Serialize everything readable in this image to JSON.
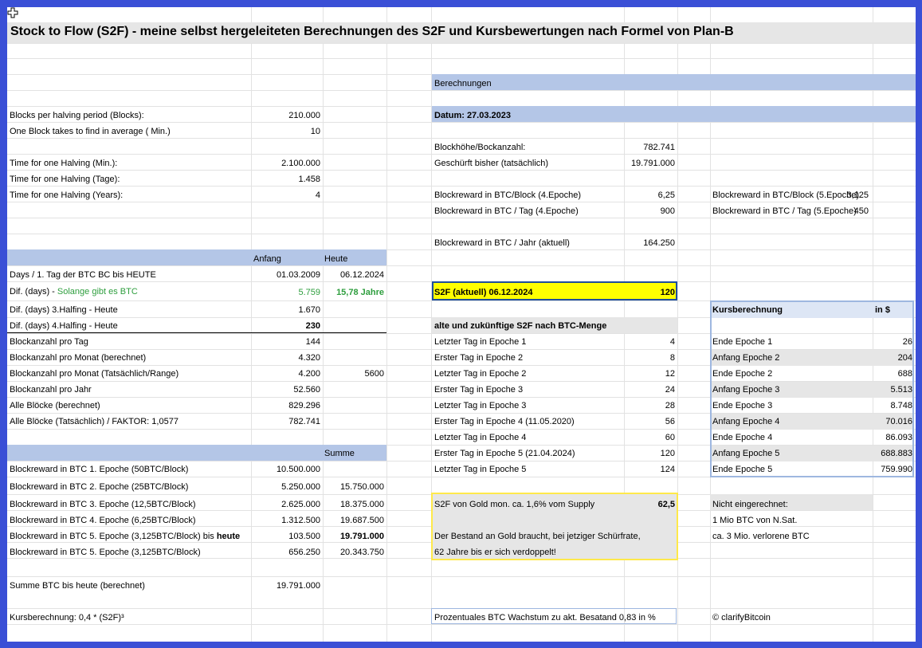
{
  "title": "Stock to Flow (S2F) - meine selbst hergeleiteten Berechnungen des S2F und Kursbewertungen nach Formel von Plan-B",
  "left": {
    "halving": [
      {
        "label": "Blocks per halving period (Blocks):",
        "value": "210.000"
      },
      {
        "label": "One Block takes to find in average ( Min.)",
        "value": "10"
      },
      {
        "label": "Time for one Halving (Min.):",
        "value": "2.100.000"
      },
      {
        "label": "Time for one Halving (Tage):",
        "value": "1.458"
      },
      {
        "label": "Time for one Halving (Years):",
        "value": "4"
      }
    ],
    "header_anfang": "Anfang",
    "header_heute": "Heute",
    "days": {
      "label": "Days / 1. Tag der BTC BC bis  HEUTE",
      "anfang": "01.03.2009",
      "heute": "06.12.2024"
    },
    "dif": {
      "label_a": "Dif. (days) - ",
      "label_b": "Solange gibt es BTC",
      "value": "5.759",
      "years": "15,78  Jahre"
    },
    "halfing3": {
      "label": "Dif. (days) 3.Halfing - Heute",
      "value": "1.670"
    },
    "halfing4": {
      "label": "Dif. (days) 4.Halfing - Heute",
      "value": "230"
    },
    "blocks": [
      {
        "label": "Blockanzahl pro Tag",
        "value": "144",
        "extra": ""
      },
      {
        "label": "Blockanzahl pro Monat (berechnet)",
        "value": "4.320",
        "extra": ""
      },
      {
        "label": "Blockanzahl pro Monat (Tatsächlich/Range)",
        "value": "4.200",
        "extra": "5600"
      },
      {
        "label": "Blockanzahl pro Jahr",
        "value": "52.560",
        "extra": ""
      },
      {
        "label": "Alle Blöcke (berechnet)",
        "value": "829.296",
        "extra": ""
      },
      {
        "label": "Alle Blöcke (Tatsächlich) / FAKTOR: 1,0577",
        "value": "782.741",
        "extra": ""
      }
    ],
    "summe_header": "Summe",
    "epochs": [
      {
        "label": "Blockreward in BTC 1. Epoche (50BTC/Block)",
        "value": "10.500.000",
        "sum": ""
      },
      {
        "label": "Blockreward in BTC 2. Epoche (25BTC/Block)",
        "value": "5.250.000",
        "sum": "15.750.000"
      },
      {
        "label": "Blockreward in BTC 3. Epoche (12,5BTC/Block)",
        "value": "2.625.000",
        "sum": "18.375.000"
      },
      {
        "label": "Blockreward in BTC 4. Epoche (6,25BTC/Block)",
        "value": "1.312.500",
        "sum": "19.687.500"
      },
      {
        "label": "Blockreward in BTC 5. Epoche (3,125BTC/Block) bis ",
        "label_bold": "heute",
        "value": "103.500",
        "sum": "19.791.000"
      },
      {
        "label": "Blockreward in BTC 5. Epoche (3,125BTC/Block)",
        "value": "656.250",
        "sum": "20.343.750"
      }
    ],
    "summe_btc": {
      "label": "Summe BTC bis heute (berechnet)",
      "value": "19.791.000"
    },
    "kursberechnung": "Kursberechnung: 0,4 * (S2F)³"
  },
  "middle": {
    "berechnungen": "Berechnungen",
    "datum": "Datum: 27.03.2023",
    "rows": [
      {
        "label": "Blockhöhe/Bockanzahl:",
        "value": "782.741"
      },
      {
        "label": "Geschürft bisher (tatsächlich)",
        "value": "19.791.000"
      },
      {
        "label": "Blockreward in BTC/Block (4.Epoche)",
        "value": "6,25"
      },
      {
        "label": "Blockreward in BTC / Tag (4.Epoche)",
        "value": "900"
      },
      {
        "label": "Blockreward in BTC / Jahr (aktuell)",
        "value": "164.250"
      }
    ],
    "s2f_label": "S2F (aktuell) 06.12.2024",
    "s2f_value": "120",
    "s2f_header": "alte und zukünftige S2F nach BTC-Menge",
    "s2f_rows": [
      {
        "label": "Letzter Tag in Epoche 1",
        "value": "4"
      },
      {
        "label": "Erster Tag in Epoche 2",
        "value": "8"
      },
      {
        "label": "Letzter Tag in Epoche 2",
        "value": "12"
      },
      {
        "label": "Erster Tag in Epoche 3",
        "value": "24"
      },
      {
        "label": "Letzter Tag in Epoche 3",
        "value": "28"
      },
      {
        "label": "Erster Tag in Epoche 4 (11.05.2020)",
        "value": "56"
      },
      {
        "label": "Letzter Tag in Epoche 4",
        "value": "60"
      },
      {
        "label": "Erster Tag in Epoche 5 (21.04.2024)",
        "value": "120"
      },
      {
        "label": "Letzter Tag in Epoche 5",
        "value": "124"
      }
    ],
    "gold_label": "S2F von Gold mon. ca. 1,6% vom Supply",
    "gold_value": "62,5",
    "gold_text1": "Der Bestand an Gold braucht, bei jetziger Schürfrate,",
    "gold_text2": "62 Jahre bis er sich verdoppelt!",
    "wachstum": "Prozentuales BTC Wachstum zu akt. Besatand  0,83  in %"
  },
  "right": {
    "rows": [
      {
        "label": "Blockreward in BTC/Block (5.Epoche)",
        "value": "3,125"
      },
      {
        "label": "Blockreward in BTC / Tag (5.Epoche)",
        "value": "450"
      }
    ],
    "kurs_header": "Kursberechnung",
    "kurs_unit": "in $",
    "kurs_rows": [
      {
        "label": "Ende Epoche 1",
        "value": "26"
      },
      {
        "label": "Anfang Epoche 2",
        "value": "204"
      },
      {
        "label": "Ende Epoche 2",
        "value": "688"
      },
      {
        "label": "Anfang Epoche 3",
        "value": "5.513"
      },
      {
        "label": "Ende Epoche 3",
        "value": "8.748"
      },
      {
        "label": "Anfang Epoche 4",
        "value": "70.016"
      },
      {
        "label": "Ende Epoche 4",
        "value": "86.093"
      },
      {
        "label": "Anfang Epoche 5",
        "value": "688.883"
      },
      {
        "label": "Ende Epoche 5",
        "value": "759.990"
      }
    ],
    "nicht_header": "Nicht eingerechnet:",
    "nicht_rows": [
      "1 Mio BTC von N.Sat.",
      "ca. 3 Mio. verlorene BTC"
    ],
    "copyright": "© clarifyBitcoin"
  }
}
